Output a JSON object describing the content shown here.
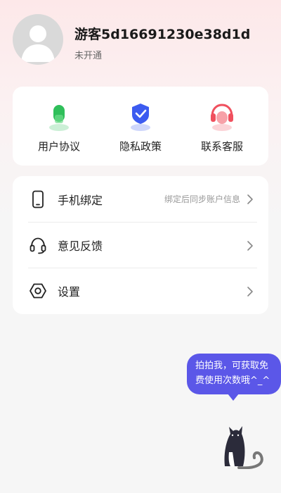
{
  "profile": {
    "username": "游客5d16691230e38d1d",
    "status": "未开通"
  },
  "quick_actions": [
    {
      "label": "用户协议",
      "icon": "user-agreement-icon",
      "color": "#2fbf5a"
    },
    {
      "label": "隐私政策",
      "icon": "shield-check-icon",
      "color": "#3c5bf0"
    },
    {
      "label": "联系客服",
      "icon": "headset-support-icon",
      "color": "#f0505e"
    }
  ],
  "menu": [
    {
      "label": "手机绑定",
      "hint": "绑定后同步账户信息",
      "icon": "phone-icon"
    },
    {
      "label": "意见反馈",
      "hint": "",
      "icon": "headphones-icon"
    },
    {
      "label": "设置",
      "hint": "",
      "icon": "hexagon-settings-icon"
    }
  ],
  "mascot": {
    "bubble_text": "拍拍我，可获取免费使用次数哦^_^",
    "icon": "cat-icon"
  }
}
